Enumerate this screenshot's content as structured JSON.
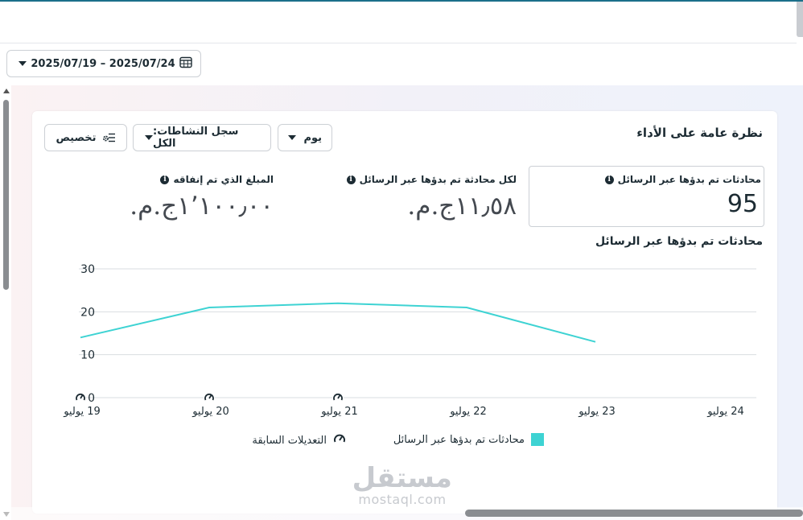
{
  "date_range": {
    "label": "2025/07/19 – 2025/07/24",
    "icon": "calendar-icon"
  },
  "card": {
    "title": "نظرة عامة على الأداء",
    "controls": {
      "day": "يوم",
      "activity_log": "سجل النشاطات: الكل",
      "customize": "تخصيص"
    },
    "metrics": [
      {
        "label": "محادثات تم بدؤها عبر الرسائل",
        "value": "95"
      },
      {
        "label": "لكل محادثة تم بدؤها عبر الرسائل",
        "value": "١١٫٥٨ج.م."
      },
      {
        "label": "المبلغ الذي تم إنفاقه",
        "value": "١٬١٠٠٫٠٠ج.م."
      }
    ],
    "chart_title": "محادثات تم بدؤها عبر الرسائل"
  },
  "chart_data": {
    "type": "line",
    "x": [
      "19 يوليو",
      "20 يوليو",
      "21 يوليو",
      "22 يوليو",
      "23 يوليو",
      "24 يوليو"
    ],
    "series": [
      {
        "name": "محادثات تم بدؤها عبر الرسائل",
        "values": [
          14,
          21,
          22,
          21,
          13,
          null
        ],
        "color": "#3ed3d3"
      }
    ],
    "y_ticks": [
      0,
      10,
      20,
      30
    ],
    "ylim": [
      0,
      30
    ],
    "grid": true,
    "annotation_markers_at": [
      "19 يوليو",
      "20 يوليو",
      "21 يوليو"
    ],
    "legend": {
      "position": "bottom",
      "items": [
        {
          "label": "محادثات تم بدؤها عبر الرسائل",
          "icon": "teal-square"
        },
        {
          "label": "التعديلات السابقة",
          "icon": "gauge-icon"
        }
      ]
    }
  },
  "watermark": {
    "main": "مستقل",
    "sub": "mostaql.com"
  }
}
